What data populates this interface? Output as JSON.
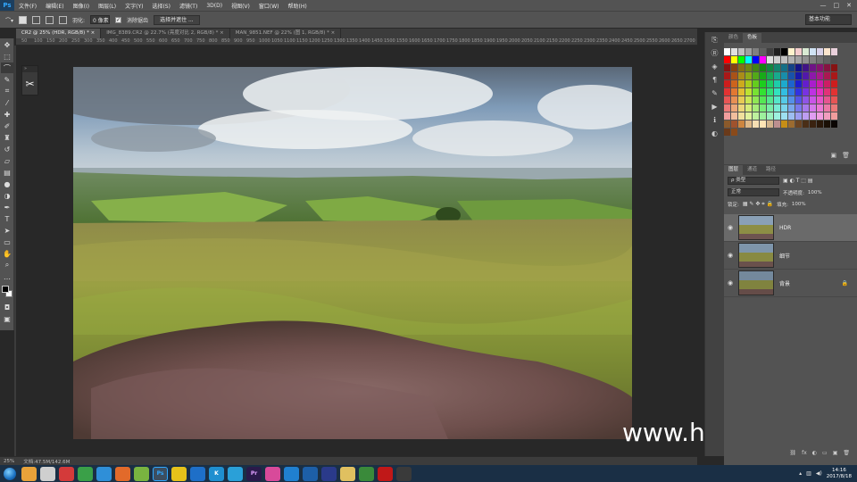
{
  "app": {
    "logo": "Ps"
  },
  "menu": [
    "文件(F)",
    "编辑(E)",
    "图像(I)",
    "图层(L)",
    "文字(Y)",
    "选择(S)",
    "滤镜(T)",
    "3D(D)",
    "视图(V)",
    "窗口(W)",
    "帮助(H)"
  ],
  "window_controls": [
    "—",
    "□",
    "✕"
  ],
  "options": {
    "feather_label": "羽化:",
    "feather_value": "0 像素",
    "antialias_label": "消除锯齿",
    "select_mask_button": "选择并遮住 ...",
    "workspace": "基本功能"
  },
  "tabs": [
    {
      "label": "CR2 @ 25% (HDR, RGB/8) * ×",
      "active": true
    },
    {
      "label": "IMG_8389.CR2 @ 22.7% (亮度对比 2, RGB/8) * ×",
      "active": false
    },
    {
      "label": "MAN_9851.NEF @ 22% (图 1, RGB/8) * ×",
      "active": false
    }
  ],
  "ruler_ticks": [
    "50",
    "100",
    "150",
    "200",
    "250",
    "300",
    "350",
    "400",
    "450",
    "500",
    "550",
    "600",
    "650",
    "700",
    "750",
    "800",
    "850",
    "900",
    "950",
    "1000",
    "1050",
    "1100",
    "1150",
    "1200",
    "1250",
    "1300",
    "1350",
    "1400",
    "1450",
    "1500",
    "1550",
    "1600",
    "1650",
    "1700",
    "1750",
    "1800",
    "1850",
    "1900",
    "1950",
    "2000",
    "2050",
    "2100",
    "2150",
    "2200",
    "2250",
    "2300",
    "2350",
    "2400",
    "2450",
    "2500",
    "2550",
    "2600",
    "2650",
    "2700",
    "2750",
    "2800",
    "2850",
    "2900",
    "2950",
    "3000",
    "3050",
    "3100",
    "3150",
    "3200",
    "3250",
    "3300",
    "3350",
    "3400",
    "3450",
    "3500",
    "3550",
    "3600",
    "3650",
    "3700",
    "3750",
    "3800",
    "3850",
    "3900",
    "3950",
    "4000",
    "4050",
    "4100",
    "4150",
    "4200",
    "4250",
    "4300",
    "4350",
    "4400",
    "4450",
    "4500",
    "4550",
    "4600",
    "4650",
    "4700",
    "4750",
    "4800",
    "4850",
    "4900",
    "4950",
    "5000",
    "5050",
    "5100",
    "5150",
    "5200",
    "5250",
    "5300",
    "5350",
    "5400"
  ],
  "tools": [
    "move-tool",
    "marquee-tool",
    "lasso-tool",
    "quick-select-tool",
    "crop-tool",
    "eyedropper-tool",
    "healing-brush-tool",
    "brush-tool",
    "clone-stamp-tool",
    "history-brush-tool",
    "eraser-tool",
    "gradient-tool",
    "blur-tool",
    "dodge-tool",
    "pen-tool",
    "type-tool",
    "path-select-tool",
    "rectangle-tool",
    "hand-tool",
    "zoom-tool",
    "more-tools"
  ],
  "status": {
    "zoom": "25%",
    "doc": "文档:47.5M/142.6M"
  },
  "watermark": "www.hunls.com",
  "right_panels": {
    "color_tabs": [
      "颜色",
      "色板"
    ],
    "layer_tabs": [
      "图层",
      "通道",
      "路径"
    ],
    "filter_kind": "ρ 类型",
    "blend_mode": "正常",
    "opacity_label": "不透明度:",
    "opacity_value": "100%",
    "lock_label": "锁定:",
    "fill_label": "填充:",
    "fill_value": "100%",
    "layers": [
      {
        "name": "HDR",
        "selected": true,
        "locked": false
      },
      {
        "name": "细节",
        "selected": false,
        "locked": false
      },
      {
        "name": "背景",
        "selected": false,
        "locked": true
      }
    ],
    "layers_footer": [
      "fx",
      "◐",
      "▭",
      "▣",
      "🗑"
    ]
  },
  "taskbar": {
    "apps": [
      "Ps",
      "Pr",
      "K",
      "Ae"
    ],
    "time": "14:16",
    "date": "2017/8/18"
  }
}
